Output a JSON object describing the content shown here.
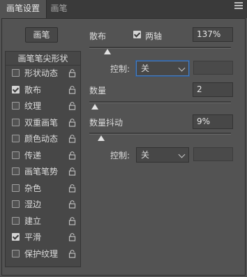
{
  "tabs": [
    {
      "label": "画笔设置"
    },
    {
      "label": "画笔"
    }
  ],
  "presets_button": "画笔",
  "list": {
    "header": "画笔笔尖形状",
    "items": [
      {
        "label": "形状动态",
        "checked": false
      },
      {
        "label": "散布",
        "checked": true
      },
      {
        "label": "纹理",
        "checked": false
      },
      {
        "label": "双重画笔",
        "checked": false
      },
      {
        "label": "颜色动态",
        "checked": false
      },
      {
        "label": "传递",
        "checked": false
      },
      {
        "label": "画笔笔势",
        "checked": false
      },
      {
        "label": "杂色",
        "checked": false
      },
      {
        "label": "湿边",
        "checked": false
      },
      {
        "label": "建立",
        "checked": false
      },
      {
        "label": "平滑",
        "checked": true
      },
      {
        "label": "保护纹理",
        "checked": false
      }
    ]
  },
  "scatter": {
    "label": "散布",
    "both_axes_label": "两轴",
    "both_axes_checked": true,
    "value": "137%",
    "slider_fraction": 0.137,
    "control_label": "控制:",
    "control_value": "关"
  },
  "count": {
    "label": "数量",
    "value": "2",
    "slider_fraction": 0.0
  },
  "count_jitter": {
    "label": "数量抖动",
    "value": "9%",
    "slider_fraction": 0.09,
    "control_label": "控制:",
    "control_value": "关"
  }
}
